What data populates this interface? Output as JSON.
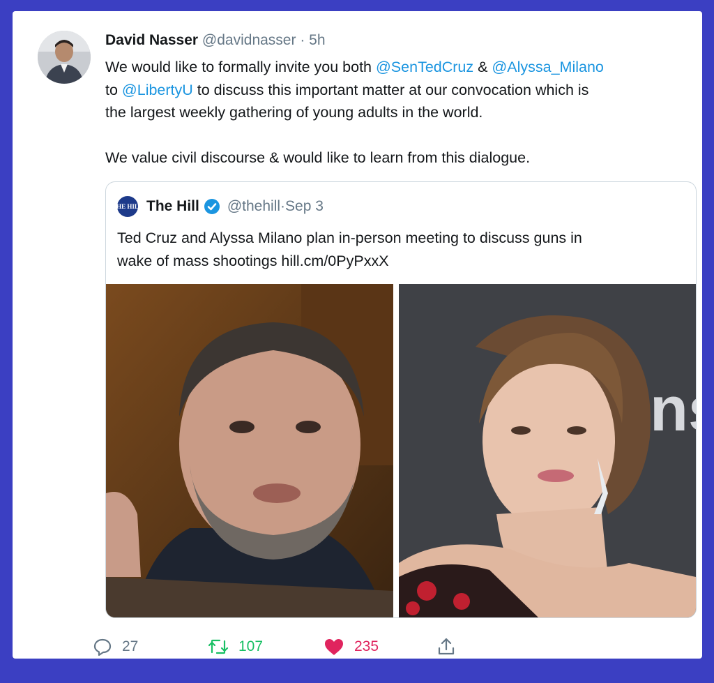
{
  "tweet": {
    "author_name": "David Nasser",
    "author_handle": "@davidnasser",
    "separator": " · ",
    "time": "5h",
    "body": {
      "line1_pre": "We would like to formally invite you both ",
      "mention1": "@SenTedCruz",
      "line1_mid": " & ",
      "mention2": "@Alyssa_Milano",
      "line2_pre": "to ",
      "mention3": "@LibertyU",
      "line2_post": " to discuss this important matter at our convocation which is",
      "line3": "the largest weekly gathering of young adults in the world.",
      "line4": "We value civil discourse & would like to learn from this dialogue."
    }
  },
  "quoted": {
    "logo_text": "THE HILL",
    "author_name": "The Hill",
    "author_handle": "@thehill",
    "separator": " · ",
    "date": "Sep 3",
    "line1": "Ted Cruz and Alyssa Milano plan in-person meeting to discuss guns in",
    "line2": "wake of mass shootings hill.cm/0PyPxxX"
  },
  "actions": {
    "replies": "27",
    "retweets": "107",
    "likes": "235"
  },
  "colors": {
    "frame": "#3b3fc2",
    "link": "#1b95e0",
    "retweet": "#17bf63",
    "like": "#e0245e",
    "muted": "#657786"
  },
  "icons": [
    "reply-icon",
    "retweet-icon",
    "heart-icon",
    "share-icon",
    "verified-badge-icon"
  ]
}
